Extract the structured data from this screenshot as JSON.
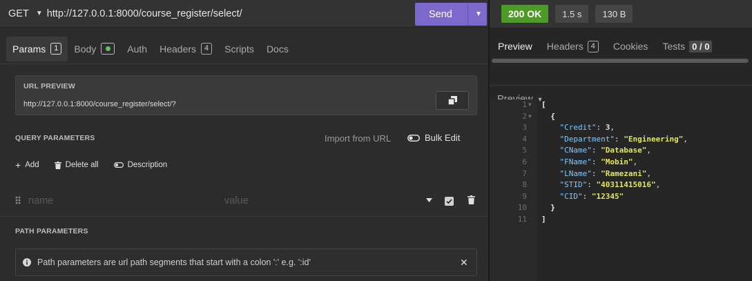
{
  "request": {
    "method": "GET",
    "url": "http://127.0.0.1:8000/course_register/select/",
    "send_label": "Send"
  },
  "tabs": [
    {
      "label": "Params",
      "badge": "1"
    },
    {
      "label": "Body"
    },
    {
      "label": "Auth"
    },
    {
      "label": "Headers",
      "badge": "4"
    },
    {
      "label": "Scripts"
    },
    {
      "label": "Docs"
    }
  ],
  "url_preview": {
    "title": "URL PREVIEW",
    "url": "http://127.0.0.1:8000/course_register/select/?"
  },
  "query_params": {
    "title": "QUERY PARAMETERS",
    "import_label": "Import from URL",
    "bulk_edit_label": "Bulk Edit",
    "add_label": "Add",
    "delete_all_label": "Delete all",
    "description_label": "Description",
    "name_placeholder": "name",
    "value_placeholder": "value"
  },
  "path_params": {
    "title": "PATH PARAMETERS",
    "info": "Path parameters are url path segments that start with a colon ':' e.g. ':id'"
  },
  "response": {
    "status": "200 OK",
    "time": "1.5 s",
    "size": "130 B",
    "tabs": [
      {
        "label": "Preview"
      },
      {
        "label": "Headers",
        "badge": "4"
      },
      {
        "label": "Cookies"
      },
      {
        "label": "Tests",
        "badge": "0 / 0"
      }
    ],
    "preview_mode": "Preview",
    "body": [
      {
        "Credit": 3,
        "Department": "Engineering",
        "CName": "Database",
        "FName": "Mobin",
        "LName": "Ramezani",
        "STID": "40311415016",
        "CID": "12345"
      }
    ]
  },
  "colors": {
    "send": "#7d69cb",
    "status_ok": "#4c9b25",
    "json_key": "#7fc9ff",
    "json_string": "#e5e55a"
  }
}
